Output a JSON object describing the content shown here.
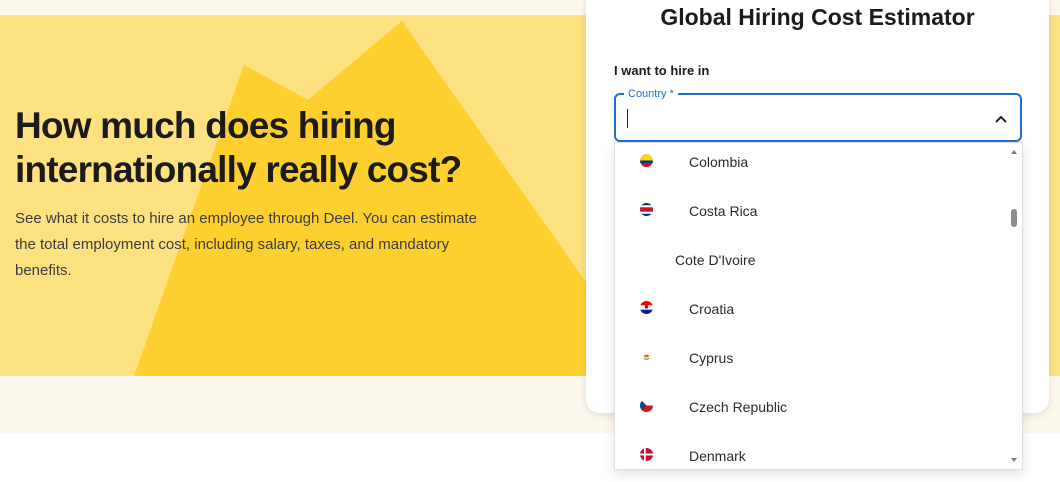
{
  "hero": {
    "title": "How much does hiring internationally really cost?",
    "description": "See what it costs to hire an employee through Deel. You can estimate the total employment cost, including salary, taxes, and mandatory benefits."
  },
  "estimator": {
    "title": "Global Hiring Cost Estimator",
    "field_label": "I want to hire in",
    "country_legend": "Country *",
    "country_value": "",
    "options": [
      {
        "label": "Colombia",
        "flag": "colombia-flag-icon"
      },
      {
        "label": "Costa Rica",
        "flag": "costa-rica-flag-icon"
      },
      {
        "label": "Cote D'Ivoire",
        "flag": ""
      },
      {
        "label": "Croatia",
        "flag": "croatia-flag-icon"
      },
      {
        "label": "Cyprus",
        "flag": "cyprus-flag-icon"
      },
      {
        "label": "Czech Republic",
        "flag": "czech-republic-flag-icon"
      },
      {
        "label": "Denmark",
        "flag": "denmark-flag-icon"
      }
    ]
  },
  "colors": {
    "hero_bg": "#fee180",
    "accent_yellow": "#fdd02f",
    "focus_blue": "#1e6fd0"
  }
}
